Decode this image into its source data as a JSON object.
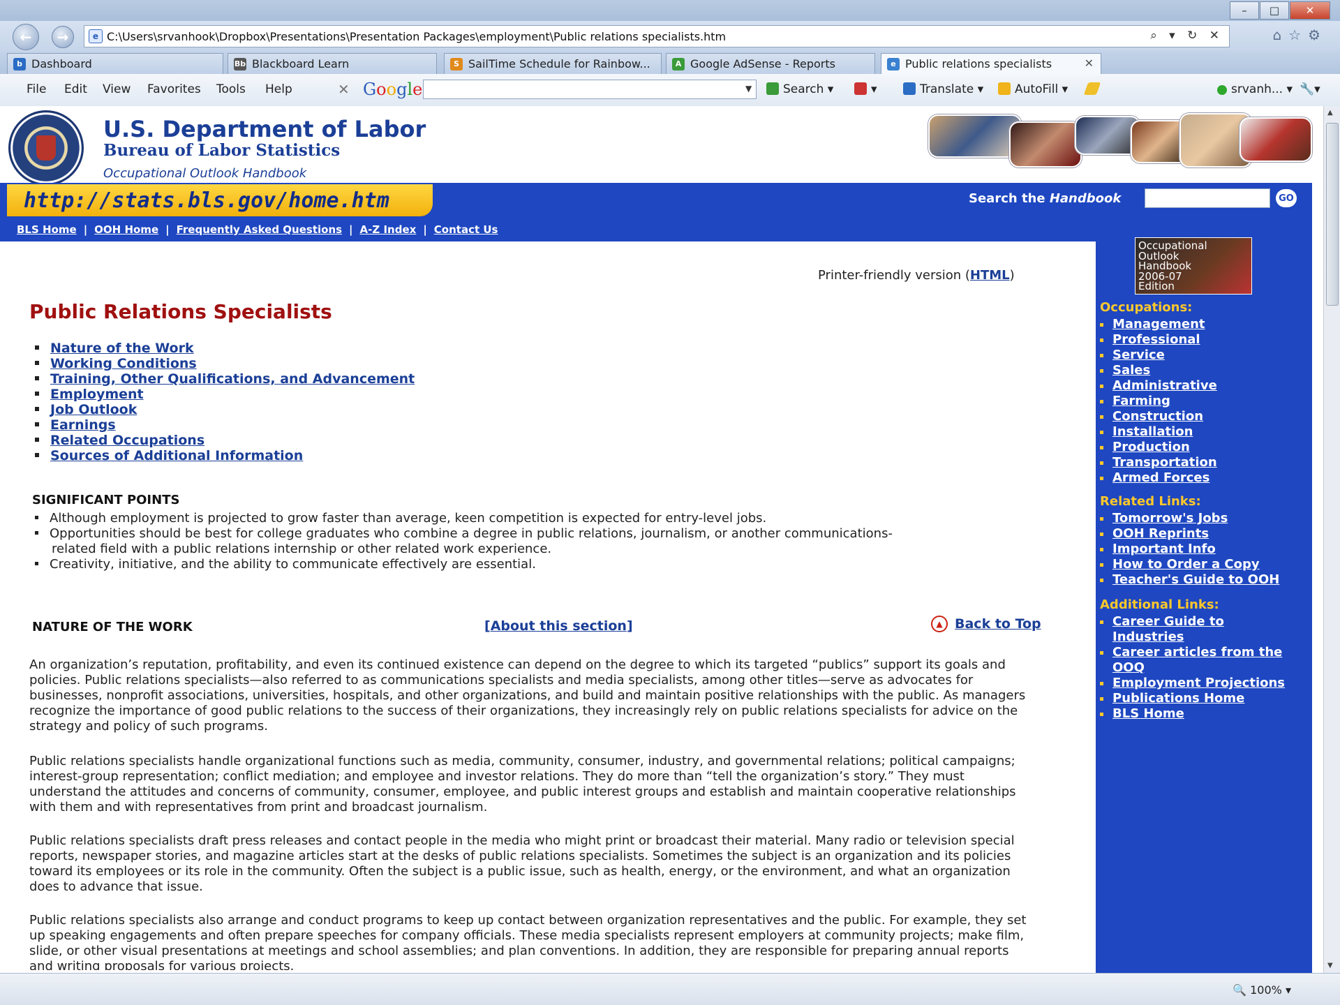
{
  "browser": {
    "address": "C:\\Users\\srvanhook\\Dropbox\\Presentations\\Presentation Packages\\employment\\Public relations specialists.htm",
    "address_tools": "⌕ ▾ ↻ ✕",
    "tabs": [
      {
        "label": "Dashboard",
        "icon_color": "#2b6cc4",
        "icon_glyph": "b"
      },
      {
        "label": "Blackboard Learn",
        "icon_color": "#555555",
        "icon_glyph": "Bb"
      },
      {
        "label": "SailTime Schedule for Rainbow...",
        "icon_color": "#e08a1b",
        "icon_glyph": "S"
      },
      {
        "label": "Google AdSense - Reports",
        "icon_color": "#3a9b3a",
        "icon_glyph": "A"
      },
      {
        "label": "Public relations specialists",
        "icon_color": "#3a80d0",
        "icon_glyph": "e"
      }
    ],
    "menu": [
      "File",
      "Edit",
      "View",
      "Favorites",
      "Tools",
      "Help"
    ],
    "toolbar": {
      "google": "Google",
      "search": "Search",
      "translate": "Translate",
      "autofill": "AutoFill",
      "user": "srvanh..."
    },
    "zoom": "100%"
  },
  "page": {
    "dol_title": "U.S. Department of Labor",
    "bls_title": "Bureau of Labor Statistics",
    "ooh_title": "Occupational Outlook Handbook",
    "url": "http://stats.bls.gov/home.htm",
    "search_label_prefix": "Search the ",
    "search_label_em": "Handbook",
    "go": "GO",
    "nav_links": [
      "BLS Home",
      "OOH Home",
      "Frequently Asked Questions",
      "A-Z Index",
      "Contact Us"
    ],
    "printer_prefix": "Printer-friendly version (",
    "printer_link": "HTML",
    "printer_suffix": ")",
    "title": "Public Relations Specialists",
    "toc": [
      "Nature of the Work",
      "Working Conditions",
      "Training, Other Qualifications, and Advancement",
      "Employment",
      "Job Outlook",
      "Earnings",
      "Related Occupations",
      "Sources of Additional Information"
    ],
    "significant_heading": "SIGNIFICANT POINTS",
    "significant_points": [
      "Although employment is projected to grow faster than average, keen competition is expected for entry-level jobs.",
      "Opportunities should be best for college graduates who combine a degree in public relations, journalism, or another communications-",
      "related field with a public relations internship or other related work experience.",
      "Creativity, initiative, and the ability to communicate effectively are essential."
    ],
    "nature_heading": "NATURE OF THE WORK",
    "about_section": "About this section",
    "back_to_top": "Back to Top",
    "paragraphs": [
      "An organization’s reputation, profitability, and even its continued existence can depend on the degree to which its targeted “publics” support its goals and policies. Public relations specialists—also referred to as communications specialists and media specialists, among other titles—serve as advocates for businesses, nonprofit associations, universities, hospitals, and other organizations, and build and maintain positive relationships with the public. As managers recognize the importance of good public relations to the success of their organizations, they increasingly rely on public relations specialists for advice on the strategy and policy of such programs.",
      "Public relations specialists handle organizational functions such as media, community, consumer, industry, and governmental relations; political campaigns; interest-group representation; conflict mediation; and employee and investor relations. They do more than “tell the organization’s story.” They must understand the attitudes and concerns of community, consumer, employee, and public interest groups and establish and maintain cooperative relationships with them and with representatives from print and broadcast journalism.",
      "Public relations specialists draft press releases and contact people in the media who might print or broadcast their material. Many radio or television special reports, newspaper stories, and magazine articles start at the desks of public relations specialists. Sometimes the subject is an organization and its policies toward its employees or its role in the community. Often the subject is a public issue, such as health, energy, or the environment, and what an organization does to advance that issue.",
      "Public relations specialists also arrange and conduct programs to keep up contact between organization representatives and the public. For example, they set up speaking engagements and often prepare speeches for company officials. These media specialists represent employers at community projects; make film, slide, or other visual presentations at meetings and school assemblies; and plan conventions. In addition, they are responsible for preparing annual reports and writing proposals for various projects."
    ],
    "sidebar": {
      "cover": [
        "Occupational",
        "Outlook",
        "Handbook",
        "2006-07",
        "Edition"
      ],
      "occupations_heading": "Occupations:",
      "occupations": [
        "Management",
        "Professional",
        "Service",
        "Sales",
        "Administrative",
        "Farming",
        "Construction",
        "Installation",
        "Production",
        "Transportation",
        "Armed Forces"
      ],
      "related_heading": "Related Links:",
      "related": [
        "Tomorrow's Jobs",
        "OOH Reprints",
        "Important Info",
        "How to Order a Copy",
        "Teacher's Guide to OOH"
      ],
      "additional_heading": "Additional Links:",
      "additional": [
        "Career Guide to",
        "Industries",
        "Career articles from the",
        "OOQ",
        "Employment Projections",
        "Publications Home",
        "BLS Home"
      ]
    }
  }
}
